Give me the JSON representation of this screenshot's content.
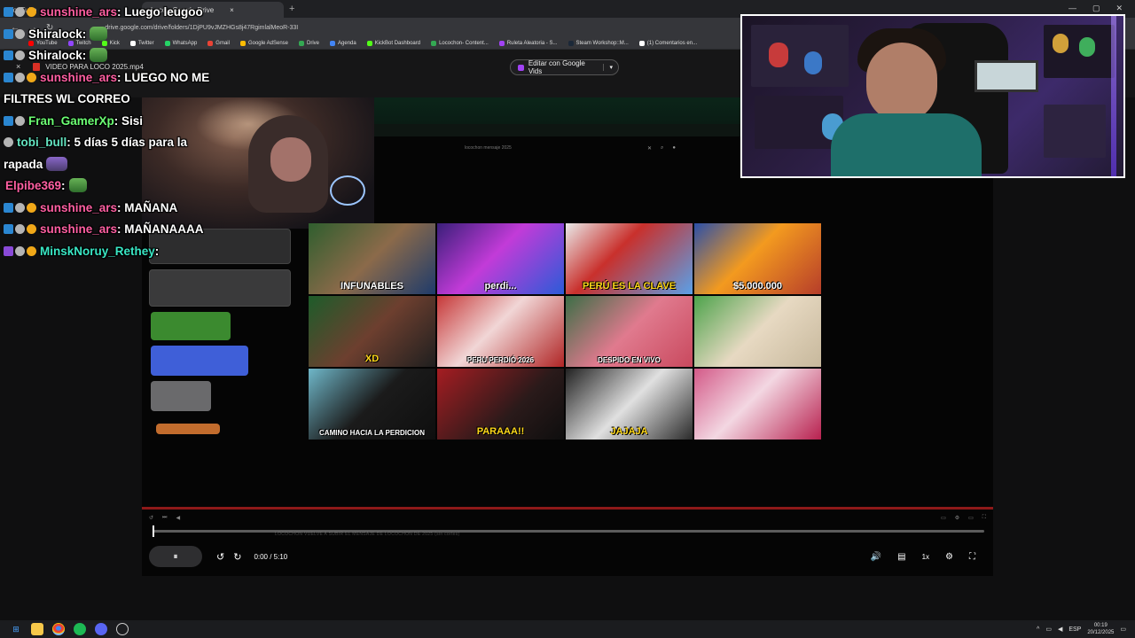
{
  "browser": {
    "tabs": [
      {
        "label": "YouTube"
      },
      {
        "label": "Loco - Google Drive"
      }
    ],
    "new_tab": "+",
    "tab_close": "×",
    "url": "drive.google.com/drive/folders/1DjPU9vJMZHGs8j47RgimlalMeoR-33I",
    "bookmarks": [
      {
        "label": "YouTube",
        "color": "#ff0000"
      },
      {
        "label": "Twitch",
        "color": "#9146ff"
      },
      {
        "label": "Kick",
        "color": "#53fc18"
      },
      {
        "label": "Twitter",
        "color": "#ffffff"
      },
      {
        "label": "WhatsApp",
        "color": "#25d366"
      },
      {
        "label": "Gmail",
        "color": "#ea4335"
      },
      {
        "label": "Google AdSense",
        "color": "#fbbc04"
      },
      {
        "label": "Drive",
        "color": "#34a853"
      },
      {
        "label": "Agenda",
        "color": "#4285f4"
      },
      {
        "label": "KickBot Dashboard",
        "color": "#53fc18"
      },
      {
        "label": "Locochon- Content...",
        "color": "#34a853"
      },
      {
        "label": "Ruleta Aleatoria - S...",
        "color": "#a142f4"
      },
      {
        "label": "Steam Workshop::M...",
        "color": "#1b2838"
      },
      {
        "label": "(1) Comentarios en...",
        "color": "#ffffff"
      }
    ]
  },
  "viewer": {
    "close": "×",
    "file_name": "VIDEO PARA LOCO 2025.mp4",
    "edit_button": "Editar con Google Vids",
    "edit_caret": "▾"
  },
  "player": {
    "inner_dialog_title": "locochon mensaje 2025",
    "thumbnails": [
      {
        "label": "INFUNABLES",
        "style": "",
        "bg": "linear-gradient(135deg,#2f5e2e,#8b6a4a 50%,#1e3b6b)"
      },
      {
        "label": "perdi...",
        "style": "",
        "bg": "linear-gradient(135deg,#3a1f7a,#c23bd8 45%,#2b5bd8)"
      },
      {
        "label": "PERÚ ES LA CLAVE",
        "style": "yellow",
        "bg": "linear-gradient(135deg,#e9e9e9,#c9302c 40%,#5aa0e8)"
      },
      {
        "label": "$5.000.000",
        "style": "",
        "bg": "linear-gradient(135deg,#2b4fa8,#f39a1f 45%,#b63d2a)"
      },
      {
        "label": "XD",
        "style": "yellow",
        "bg": "linear-gradient(135deg,#1d5c2a,#6d3f2f 50%,#1f1f1f)"
      },
      {
        "label": "PERU PERDIÓ 2026",
        "style": "small",
        "bg": "linear-gradient(135deg,#c63838,#f1d6d6 45%,#b02525)"
      },
      {
        "label": "DESPIDO EN VIVO",
        "style": "small",
        "bg": "linear-gradient(135deg,#3c6e46,#e07a8e 50%,#c9495e)"
      },
      {
        "label": "",
        "style": "",
        "bg": "linear-gradient(135deg,#4da34b,#e7d9c2 50%,#c7b89c)"
      },
      {
        "label": "CAMINO HACIA LA PERDICION",
        "style": "small",
        "bg": "linear-gradient(135deg,#6fb7c9,#1b1b1b 50%,#0e0e0e)"
      },
      {
        "label": "PARAAA!!",
        "style": "yellow",
        "bg": "linear-gradient(135deg,#a51d22,#2a1a1a 60%,#0e0e0e)"
      },
      {
        "label": "JAJAJA",
        "style": "yellow",
        "bg": "linear-gradient(135deg,#222,#e0e0e0 50%,#2b2b2b)"
      },
      {
        "label": "",
        "style": "",
        "bg": "linear-gradient(135deg,#d35a88,#f3d7e2 45%,#b8214f)"
      }
    ],
    "caption": "LOCOCHON VUELVE A SUBIR EL MENSAJE DE LOCOCHON DE 2025 (sin cortes)",
    "time": "0:00 / 5:10",
    "progress": 0.0,
    "speed": "1x",
    "icons": {
      "play_pause": "⏸",
      "rewind": "↺",
      "forward": "↻",
      "volume": "🔊",
      "captions": "▤",
      "settings": "⚙",
      "fullscreen": "⛶"
    }
  },
  "chat": [
    {
      "user": "sunshine_ars",
      "user_color": "#ff5fa2",
      "badges": [
        "blue",
        "gray",
        "gold"
      ],
      "text": ": Luego leugoo",
      "emote": false
    },
    {
      "user": "Shiralock",
      "user_color": "#ffffff",
      "badges": [
        "blue",
        "gray"
      ],
      "text": ":",
      "emote": true
    },
    {
      "user": "Shiralock",
      "user_color": "#ffffff",
      "badges": [
        "blue",
        "gray"
      ],
      "text": ":",
      "emote": true
    },
    {
      "user": "sunshine_ars",
      "user_color": "#ff5fa2",
      "badges": [
        "blue",
        "gray",
        "gold"
      ],
      "text": ": LUEGO NO ME",
      "emote": false
    },
    {
      "user": "",
      "user_color": "#ffffff",
      "badges": [],
      "text": "FILTRES WL CORREO",
      "emote": false
    },
    {
      "user": "Fran_GamerXp",
      "user_color": "#6cff74",
      "badges": [
        "blue",
        "gray"
      ],
      "text": ": Sisi",
      "emote": false
    },
    {
      "user": "tobi_bull",
      "user_color": "#63e3c0",
      "badges": [
        "gray"
      ],
      "text": ": 5 días 5 días para la",
      "emote": false
    },
    {
      "user": "",
      "user_color": "#ffffff",
      "badges": [],
      "text": "rapada",
      "emote": true
    },
    {
      "user": "Elpibe369",
      "user_color": "#ff5fa2",
      "badges": [],
      "text": ":",
      "emote": true
    },
    {
      "user": "sunshine_ars",
      "user_color": "#ff5fa2",
      "badges": [
        "blue",
        "gray",
        "gold"
      ],
      "text": ": MAÑANA",
      "emote": false
    },
    {
      "user": "sunshine_ars",
      "user_color": "#ff5fa2",
      "badges": [
        "blue",
        "gray",
        "gold"
      ],
      "text": ": MAÑANAAAA",
      "emote": false
    },
    {
      "user": "MinskNoruy_Rethey",
      "user_color": "#39e6c4",
      "badges": [
        "purple",
        "gray",
        "gold"
      ],
      "text": ":",
      "emote": false
    }
  ],
  "taskbar": {
    "language": "ESP",
    "time": "00:19",
    "date": "20/12/2025"
  }
}
